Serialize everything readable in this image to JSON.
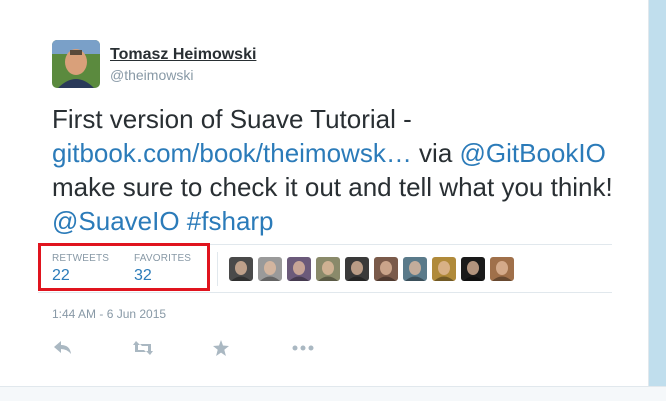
{
  "tweet": {
    "author_name": "Tomasz Heimowski",
    "author_handle": "@theimowski",
    "text_part1": "First version of Suave Tutorial - ",
    "link_url_text": "gitbook.com/book/theimowsk…",
    "text_part2": " via ",
    "mention_gitbook": "@GitBookIO",
    "text_part3": " make sure to check it out and tell what you think! ",
    "mention_suave": "@SuaveIO",
    "text_part4": " ",
    "hashtag": "#fsharp"
  },
  "stats": {
    "retweets_label": "RETWEETS",
    "retweets_count": "22",
    "favorites_label": "FAVORITES",
    "favorites_count": "32"
  },
  "favoriter_avatars": [
    {
      "color": "#4a4a4a"
    },
    {
      "color": "#9a9a9a"
    },
    {
      "color": "#6b5a7a"
    },
    {
      "color": "#8a8a6a"
    },
    {
      "color": "#3a3a3a"
    },
    {
      "color": "#7a5a4a"
    },
    {
      "color": "#5a7a8a"
    },
    {
      "color": "#b08a3a"
    },
    {
      "color": "#1a1a1a"
    },
    {
      "color": "#a0704a"
    }
  ],
  "timestamp": "1:44 AM - 6 Jun 2015",
  "actions": [
    "reply-icon",
    "retweet-icon",
    "favorite-icon",
    "more-icon"
  ],
  "colors": {
    "link": "#2b7bb9",
    "highlight_box": "#e0141e",
    "background": "#c0deed"
  }
}
